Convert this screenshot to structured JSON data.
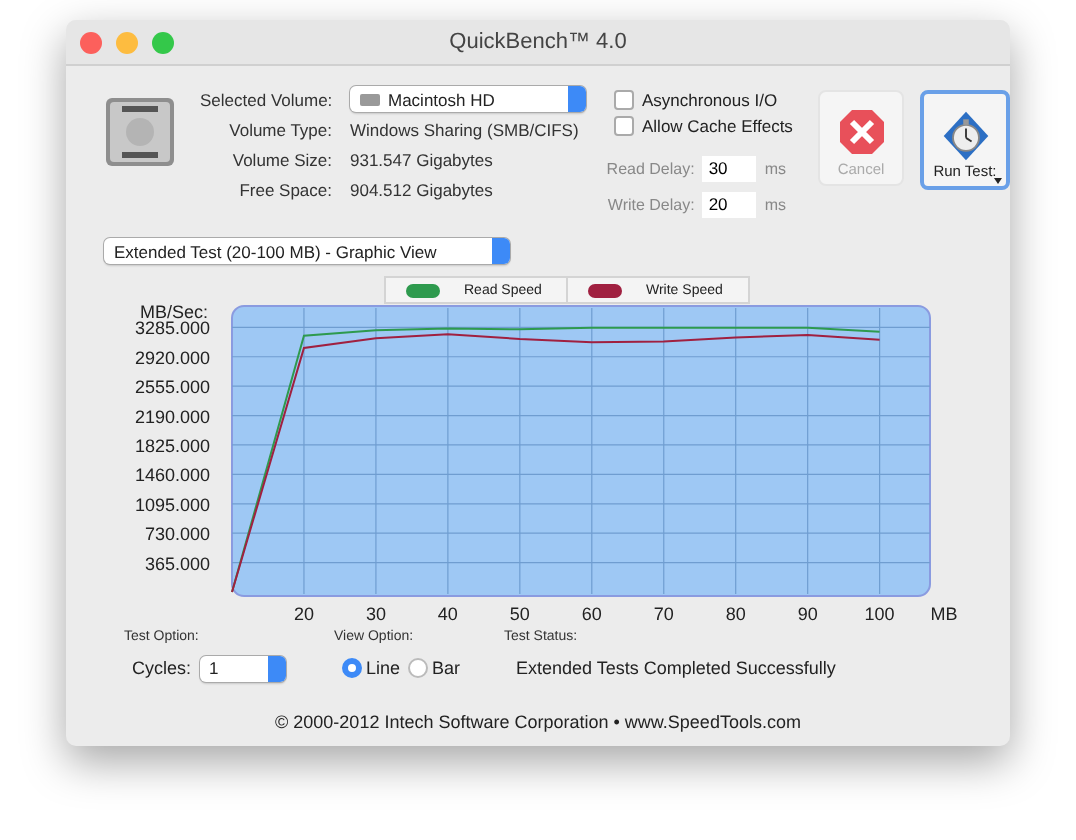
{
  "window": {
    "title": "QuickBench™ 4.0"
  },
  "volume": {
    "select_label": "Selected Volume:",
    "selected": "Macintosh HD",
    "fields": [
      {
        "label": "Volume Type:",
        "value": "Windows Sharing (SMB/CIFS)"
      },
      {
        "label": "Volume Size:",
        "value": "931.547 Gigabytes"
      },
      {
        "label": "Free Space:",
        "value": "904.512 Gigabytes"
      }
    ]
  },
  "options": [
    {
      "label": "Asynchronous I/O",
      "checked": false
    },
    {
      "label": "Allow Cache Effects",
      "checked": false
    }
  ],
  "delays": [
    {
      "label": "Read Delay:",
      "value": "30",
      "unit": "ms"
    },
    {
      "label": "Write Delay:",
      "value": "20",
      "unit": "ms"
    }
  ],
  "buttons": [
    {
      "kind": "cancel",
      "label": "Cancel",
      "disabled": true
    },
    {
      "kind": "run",
      "label": "Run Test:",
      "disabled": false
    }
  ],
  "test_select": "Extended Test (20-100 MB) - Graphic View",
  "chart_data": {
    "type": "line",
    "xlabel": "MB",
    "ylabel": "MB/Sec:",
    "x": [
      10,
      20,
      30,
      40,
      50,
      60,
      70,
      80,
      90,
      100
    ],
    "series": [
      {
        "name": "Read Speed",
        "color": "#2e9a4e",
        "values": [
          0,
          3180,
          3250,
          3270,
          3260,
          3280,
          3280,
          3280,
          3280,
          3230
        ]
      },
      {
        "name": "Write Speed",
        "color": "#a02040",
        "values": [
          0,
          3030,
          3150,
          3200,
          3140,
          3100,
          3110,
          3160,
          3190,
          3130
        ]
      }
    ],
    "grid": true,
    "xlim": [
      10,
      107
    ],
    "ylim": [
      0,
      3550
    ],
    "xticks": [
      20,
      30,
      40,
      50,
      60,
      70,
      80,
      90,
      100
    ],
    "yticks": [
      {
        "value": 365,
        "label": "365.000"
      },
      {
        "value": 730,
        "label": "730.000"
      },
      {
        "value": 1095,
        "label": "1095.000"
      },
      {
        "value": 1460,
        "label": "1460.000"
      },
      {
        "value": 1825,
        "label": "1825.000"
      },
      {
        "value": 2190,
        "label": "2190.000"
      },
      {
        "value": 2555,
        "label": "2555.000"
      },
      {
        "value": 2920,
        "label": "2920.000"
      },
      {
        "value": 3285,
        "label": "3285.000"
      }
    ]
  },
  "test_option": {
    "title": "Test Option:",
    "label": "Cycles:",
    "value": "1"
  },
  "view_option": {
    "title": "View Option:",
    "options": [
      {
        "label": "Line",
        "selected": true
      },
      {
        "label": "Bar",
        "selected": false
      }
    ]
  },
  "test_status": {
    "title": "Test Status:",
    "text": "Extended Tests Completed Successfully"
  },
  "footer": "© 2000-2012 Intech Software Corporation • www.SpeedTools.com"
}
